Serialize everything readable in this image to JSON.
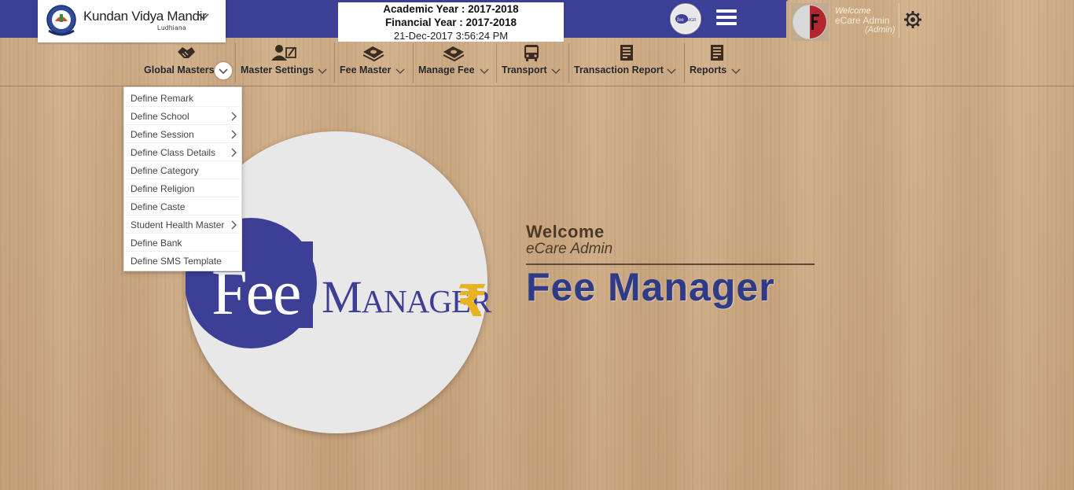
{
  "header": {
    "school_name": "Kundan Vidya Mandir",
    "school_city": "Ludhiana",
    "academic_year": "Academic Year : 2017-2018",
    "financial_year": "Financial Year : 2017-2018",
    "datetime": "21-Dec-2017 3:56:24 PM",
    "welcome_small": "Welcome",
    "user_name": "eCare Admin",
    "user_role": "(Admin)"
  },
  "menu": [
    {
      "label": "Global Masters",
      "icon": "handshake-icon"
    },
    {
      "label": "Master Settings",
      "icon": "user-edit-icon"
    },
    {
      "label": "Fee Master",
      "icon": "money-icon"
    },
    {
      "label": "Manage Fee",
      "icon": "money-icon"
    },
    {
      "label": "Transport",
      "icon": "bus-icon"
    },
    {
      "label": "Transaction Report",
      "icon": "report-icon"
    },
    {
      "label": "Reports",
      "icon": "report-icon"
    }
  ],
  "dropdown": [
    {
      "label": "Define Remark",
      "submenu": false
    },
    {
      "label": "Define School",
      "submenu": true
    },
    {
      "label": "Define Session",
      "submenu": true
    },
    {
      "label": "Define Class Details",
      "submenu": true
    },
    {
      "label": "Define Category",
      "submenu": false
    },
    {
      "label": "Define Religion",
      "submenu": false
    },
    {
      "label": "Define Caste",
      "submenu": false
    },
    {
      "label": "Student Health Master",
      "submenu": true
    },
    {
      "label": "Define Bank",
      "submenu": false
    },
    {
      "label": "Define SMS Template",
      "submenu": false
    }
  ],
  "logo": {
    "part1": "Fee",
    "part2": "Manager",
    "rupee": "₹"
  },
  "welcome": {
    "title": "Welcome",
    "user": "eCare Admin",
    "app_name": "Fee Manager"
  },
  "colors": {
    "brand_blue": "#3d3f96",
    "title_blue": "#2e3b86",
    "rupee_gold": "#e8b322"
  }
}
